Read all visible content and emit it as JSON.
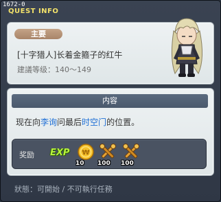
{
  "window": {
    "quest_id": "1672-0",
    "title": "QUEST INFO"
  },
  "quest": {
    "category_badge": "主要",
    "name": "[十字猎人]长着金箍子的红牛",
    "level_range": "建議等级：140～149"
  },
  "content": {
    "header": "内容",
    "text_parts": [
      "现在向",
      "李询",
      "问最后",
      "时空门",
      "的位置。"
    ]
  },
  "rewards": {
    "label": "奖励",
    "exp_label": "EXP",
    "items": [
      {
        "icon": "gold-coin-icon",
        "quantity": "10"
      },
      {
        "icon": "crossed-keys-icon",
        "quantity": "100"
      },
      {
        "icon": "crossed-keys-icon",
        "quantity": "100"
      }
    ]
  },
  "status": "狀態：可開始 / 不可執行任務",
  "colors": {
    "title": "#f3e26a",
    "highlight": "#1f6fd6",
    "exp": "#b8f23c"
  }
}
